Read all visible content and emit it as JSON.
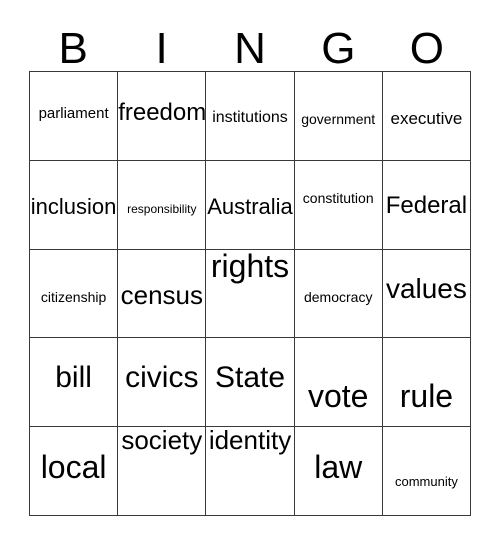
{
  "card": {
    "header_letters": [
      "B",
      "I",
      "N",
      "G",
      "O"
    ],
    "rows": [
      [
        {
          "word": "parliament"
        },
        {
          "word": "freedom"
        },
        {
          "word": "institutions"
        },
        {
          "word": "government"
        },
        {
          "word": "executive"
        }
      ],
      [
        {
          "word": "inclusion"
        },
        {
          "word": "responsibility"
        },
        {
          "word": "Australia"
        },
        {
          "word": "constitution"
        },
        {
          "word": "Federal"
        }
      ],
      [
        {
          "word": "citizenship"
        },
        {
          "word": "census"
        },
        {
          "word": "rights"
        },
        {
          "word": "democracy"
        },
        {
          "word": "values"
        }
      ],
      [
        {
          "word": "bill"
        },
        {
          "word": "civics"
        },
        {
          "word": "State"
        },
        {
          "word": "vote"
        },
        {
          "word": "rule"
        }
      ],
      [
        {
          "word": "local"
        },
        {
          "word": "society"
        },
        {
          "word": "identity"
        },
        {
          "word": "law"
        },
        {
          "word": "community"
        }
      ]
    ]
  },
  "colors": {
    "background": "#ffffff",
    "text": "#000000",
    "grid_line": "#3a3a3a"
  }
}
